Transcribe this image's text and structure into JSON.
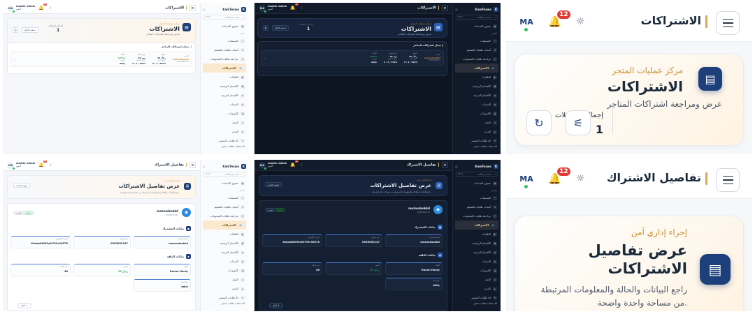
{
  "top_bar": {
    "title_list": "الاشتراكات",
    "title_details": "تفاصيل الاشتراك",
    "avatar_initials": "MA",
    "user_name": "master admin",
    "user_role": "أدمن",
    "notifications_count": "12"
  },
  "sidebar": {
    "brand": "KamTeswa",
    "search_placeholder": "بحث في القائمة...",
    "search_shortcut": "Ctrl K",
    "dashboard_label": "مفتوح الخدمات",
    "section_label": "المتجر",
    "items": [
      "السنيمات",
      "أسباب طلبات التسليم",
      "مراجعة طلبات السحوبات",
      "الاشتراكات",
      "الطلبات",
      "الأقسام الرئيسية",
      "الأقسام الفرعية",
      "السمات",
      "الكوبونات",
      "الدول",
      "المدن",
      "طلبات التسعير AI",
      "سجلات طلبات تسعير AI"
    ],
    "footer": "سجلات طلبات تسعير AI"
  },
  "list_page": {
    "eyebrow": "مركز عمليات المتجر",
    "title": "الاشتراكات",
    "subtitle": "عرض ومراجعة اشتراكات المتاجر",
    "total_label": "إجمالي السجلات",
    "total_value": "1",
    "filter_button": "تصفية النتائج",
    "records_title": "سجل اشتراكات المتاجر",
    "row": {
      "store_label": "المتجر",
      "store_value": "mezoodsokkd",
      "store_id": "0505050147",
      "amount_label": "المبلغ",
      "amount_value": "10 ريال",
      "plan_label": "نوع الخطة",
      "plan_value": "48 يوم",
      "status_label": "الحالة",
      "status_value": "active",
      "start_label": "تاريخ البدء",
      "start_value": "2 / 1 / 2024",
      "end_label": "تاريخ الانتهاء",
      "end_value": "2 / 1 / 2024",
      "period_label": "الدورة",
      "period_value": "daily"
    }
  },
  "details_page": {
    "eyebrow": "إجراء إداري آمن",
    "title": "عرض تفاصيل الاشتراكات",
    "subtitle": "راجع البيانات والحالة والمعلومات المرتبطة من مساحة واحدة واضحة.",
    "back_button": "العودة للقائمة",
    "user_name": "mezoodsokkd",
    "user_id": "0505050147",
    "status_pill": "نشطة",
    "type_pill": "شهري",
    "owner_section": "بيانات المشترك",
    "owner_fields": [
      {
        "label": "اسم المشترك",
        "value": "mezoodsokkd"
      },
      {
        "label": "رقم الجوال",
        "value": "0505050147"
      },
      {
        "label": "البريد الإلكتروني",
        "value": "Kakab660f3s097t9c96578"
      }
    ],
    "plan_section": "بيانات الباقة",
    "plan_fields": [
      {
        "label": "الباقة",
        "value": "Ronan Hardy"
      },
      {
        "label": "السعر",
        "value": "10 ريال"
      },
      {
        "label": "مدة الباقة",
        "value": "48"
      },
      {
        "label": "نوع الباقة",
        "value": "daily"
      }
    ],
    "page_pill": "اعلى"
  },
  "icons": {
    "menu": "menu-icon",
    "bell": "bell-icon",
    "sun": "sun-icon",
    "doc": "document-icon",
    "refresh": "refresh-icon",
    "filter": "filter-icon"
  },
  "colors": {
    "navy": "#1d3f7a",
    "gold": "#c7902f",
    "badge_red": "#e53935",
    "online_green": "#2fbf61",
    "dark_bg": "#0d1522"
  }
}
